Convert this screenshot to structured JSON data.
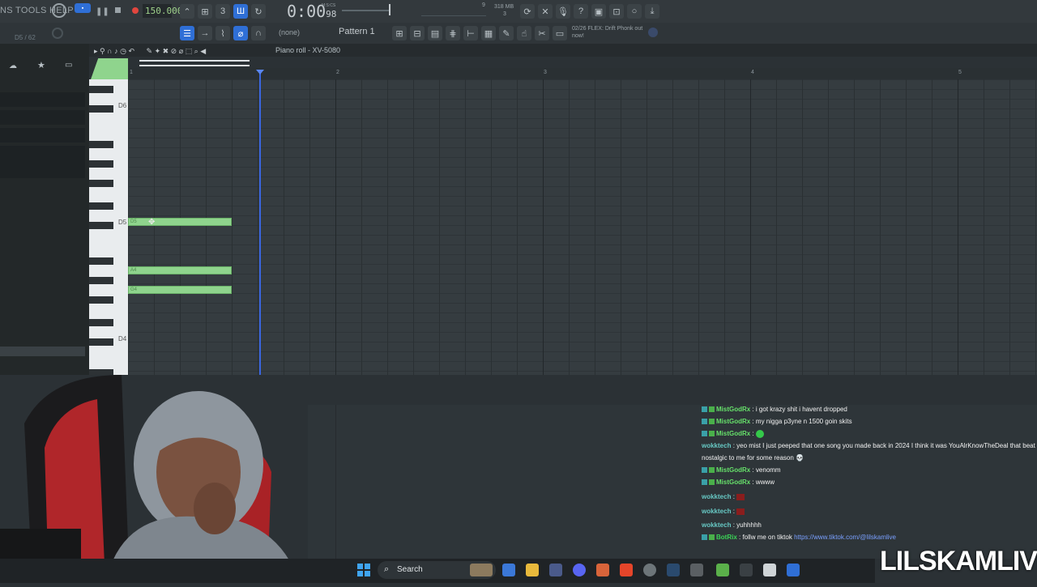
{
  "menu": {
    "items_text": "NS TOOLS HELP"
  },
  "hint": "D5 / 62",
  "transport": {
    "tempo": "150.000",
    "time_main": "0:00",
    "time_sub": "98",
    "time_unit": "M:S:CS"
  },
  "memory": {
    "value": "318 MB",
    "cpu": "9",
    "voices": "3"
  },
  "news": {
    "text": "02/26 FLEX: Drift Phonk out now!"
  },
  "toolbar2": {
    "none_label": "(none)",
    "pattern_label": "Pattern 1"
  },
  "piano_roll": {
    "title": "Piano roll - XV-5080",
    "ruler": [
      "1",
      "2",
      "3",
      "4",
      "5"
    ],
    "key_labels": {
      "d6": "D6",
      "d5": "D5",
      "d4": "D4"
    }
  },
  "notes": [
    {
      "label": "D5"
    },
    {
      "label": "A4"
    },
    {
      "label": "G4"
    }
  ],
  "chat": [
    {
      "user": "MistGodRx",
      "style": "u1",
      "badges": true,
      "msg": ": i got krazy shit i havent dropped"
    },
    {
      "user": "MistGodRx",
      "style": "u1",
      "badges": true,
      "msg": ": my nigga p3yne n 1500 goin skits"
    },
    {
      "user": "MistGodRx",
      "style": "u1",
      "badges": true,
      "msg": ":"
    },
    {
      "user": "wokktech",
      "style": "u2",
      "badges": false,
      "msg": ": yeo mist I just peeped that one song you made back in 2024 I think it was YouAlrKnowTheDeal that beat nostalgic to me for some reason 💀"
    },
    {
      "user": "MistGodRx",
      "style": "u1",
      "badges": true,
      "msg": ": venomm"
    },
    {
      "user": "MistGodRx",
      "style": "u1",
      "badges": true,
      "msg": ": wwww"
    },
    {
      "user": "wokktech",
      "style": "u2",
      "badges": false,
      "msg": ":"
    },
    {
      "user": "wokktech",
      "style": "u2",
      "badges": false,
      "msg": ":"
    },
    {
      "user": "wokktech",
      "style": "u2",
      "badges": false,
      "msg": ": yuhhhhh"
    },
    {
      "user": "BotRix",
      "style": "u3",
      "badges": true,
      "msg": ": follw me on tiktok",
      "link": "https://www.tiktok.com/@lilskamlive"
    }
  ],
  "taskbar": {
    "search_label": "Search"
  },
  "overlay": {
    "brand": "LILSKAMLIVE"
  },
  "colors": {
    "note": "#8fd48d",
    "playhead": "#3a66e0",
    "accent": "#2f6fd6"
  }
}
